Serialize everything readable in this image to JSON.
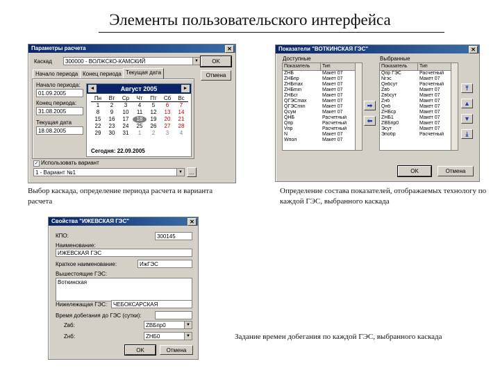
{
  "slide": {
    "title": "Элементы пользовательского интерфейса",
    "captions": {
      "first": "Выбор каскада, определение периода расчета и варианта расчета",
      "second": "Определение состава показателей, отображаемых технологу по каждой ГЭС, выбранного каскада",
      "third": "Задание времен добегания по каждой ГЭС, выбранного каскада"
    }
  },
  "window1": {
    "title": "Параметры расчета",
    "cascade_label": "Каскад",
    "cascade_value": "300000 - ВОЛЖСКО-КАМСКИЙ",
    "ok_label": "OK",
    "cancel_label": "Отмена",
    "tabs": [
      "Начало периода",
      "Конец периода",
      "Текущая дата"
    ],
    "start_label": "Начало периода:",
    "start_value": "01.09.2005",
    "end_label": "Конец периода:",
    "end_value": "31.08.2005",
    "current_label": "Текущая дата",
    "current_value": "18.08.2005",
    "calendar": {
      "month": "Август 2005",
      "prev": "◄",
      "next": "►",
      "days_header": [
        "Пн",
        "Вт",
        "Ср",
        "Чт",
        "Пт",
        "Сб",
        "Вс"
      ],
      "rows": [
        [
          "1",
          "2",
          "3",
          "4",
          "5",
          "6",
          "7"
        ],
        [
          "8",
          "9",
          "10",
          "11",
          "12",
          "13",
          "14"
        ],
        [
          "15",
          "16",
          "17",
          "18",
          "19",
          "20",
          "21"
        ],
        [
          "22",
          "23",
          "24",
          "25",
          "26",
          "27",
          "28"
        ],
        [
          "29",
          "30",
          "31",
          "1",
          "2",
          "3",
          "4"
        ]
      ],
      "selected": "18",
      "today_label": "Сегодня: 22.09.2005"
    },
    "use_variant_label": "Использовать вариант",
    "variant_value": "1 - Вариант №1",
    "browse_label": "..."
  },
  "window2": {
    "title": "Показатели \"ВОТКИНСКАЯ ГЭС\"",
    "available_label": "Доступные",
    "selected_label": "Выбранные",
    "col_indicator": "Показатель",
    "col_type": "Тип",
    "available_rows": [
      [
        "ZНБ",
        "Макет 07"
      ],
      [
        "ZНБпр",
        "Макет 07"
      ],
      [
        "ZНБmax",
        "Макет 07"
      ],
      [
        "ZНБmin",
        "Макет 07"
      ],
      [
        "ZНБcr",
        "Макет 07"
      ],
      [
        "QГЭСmax",
        "Макет 07"
      ],
      [
        "QГЭСmin",
        "Макет 07"
      ],
      [
        "Qсум",
        "Макет 07"
      ],
      [
        "QНБ",
        "Расчетный"
      ],
      [
        "Qпр",
        "Расчетный"
      ],
      [
        "Vпр",
        "Расчетный"
      ],
      [
        "N",
        "Макет 07"
      ],
      [
        "Wпол",
        "Макет 07"
      ]
    ],
    "selected_rows": [
      [
        "Qпр ГЭС",
        "Расчетный"
      ],
      [
        "Nгэс",
        "Макет 07"
      ],
      [
        "Qнбсут",
        "Расчетный"
      ],
      [
        "Zвб",
        "Макет 07"
      ],
      [
        "Zвбсут",
        "Макет 07"
      ],
      [
        "Zнб",
        "Макет 07"
      ],
      [
        "Qнб",
        "Макет 07"
      ],
      [
        "ZНБср",
        "Макет 07"
      ],
      [
        "ZНБ1",
        "Макет 07"
      ],
      [
        "ZВБпр0",
        "Макет 07"
      ],
      [
        "Эсут",
        "Макет 07"
      ],
      [
        "Эпобр",
        "Расчетный"
      ]
    ],
    "add_arrow": "➡",
    "remove_arrow": "⬅",
    "top_arrow": "⤒",
    "up_arrow": "▲",
    "down_arrow": "▼",
    "bottom_arrow": "⤓",
    "ok_label": "OK",
    "cancel_label": "Отмена"
  },
  "window3": {
    "title": "Свойства \"ИЖЕВСКАЯ ГЭС\"",
    "kpo_label": "КПО:",
    "kpo_value": "300145",
    "name_label": "Наименование:",
    "name_value": "ИЖЕВСКАЯ ГЭС",
    "short_label": "Краткое наименование:",
    "short_value": "ИжГЭС",
    "upper_label": "Вышестоящие ГЭС:",
    "upper_value": "Воткинская",
    "lower_label": "Нижележащая ГЭС:",
    "lower_value": "ЧЕБОКСАРСКАЯ",
    "travel_label": "Время добегания до ГЭС (сутки):",
    "travel_value": "",
    "zvb_label": "Zвб:",
    "zvb_value": "ZВБпр0",
    "znb_label": "Zнб:",
    "znb_value": "ZНБ0",
    "ok_label": "OK",
    "cancel_label": "Отмена"
  }
}
